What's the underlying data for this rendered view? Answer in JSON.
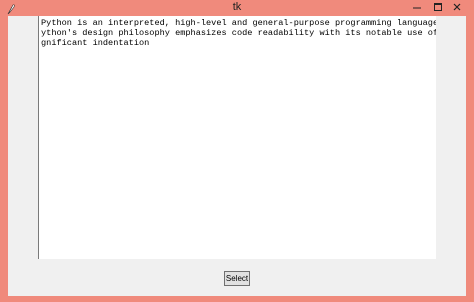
{
  "window": {
    "title": "tk",
    "icon": "feather-icon",
    "controls": [
      "minimize-icon",
      "maximize-icon",
      "close-icon"
    ]
  },
  "text_area": {
    "lines": [
      "Python is an interpreted, high-level and general-purpose programming language. P",
      "ython's design philosophy emphasizes code readability with its notable use of si",
      "gnificant indentation"
    ]
  },
  "select_button": {
    "label": "Select"
  },
  "colors": {
    "frame": "#f08a7c",
    "client_bg": "#f0f0f0",
    "text_bg": "#ffffff"
  }
}
